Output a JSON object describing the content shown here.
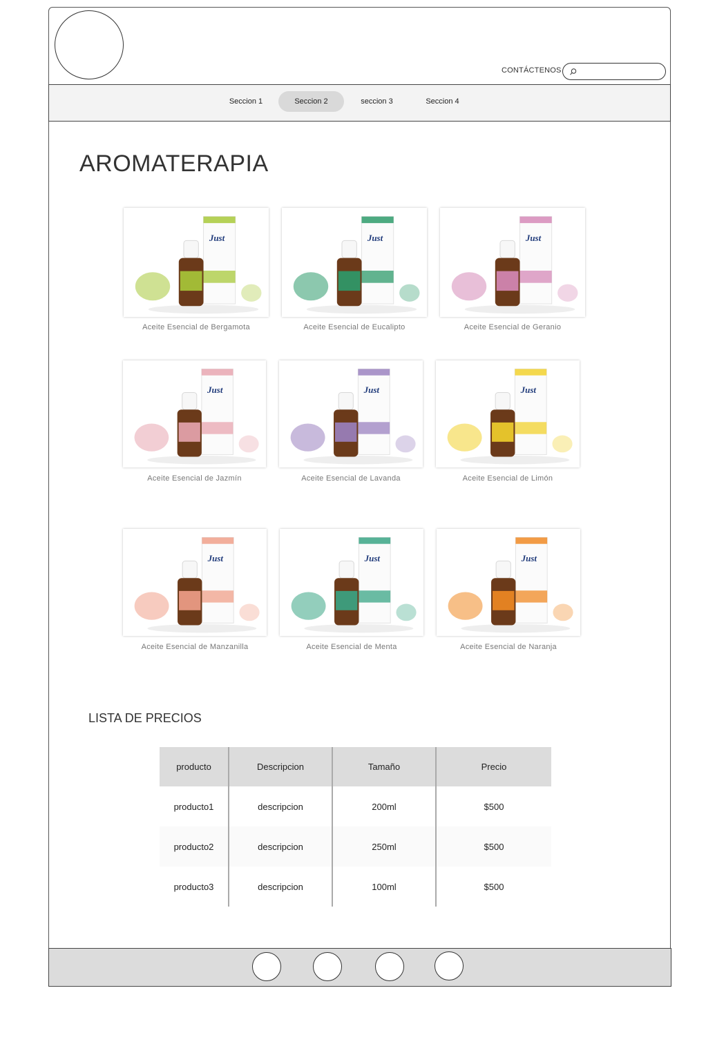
{
  "header": {
    "contact_label": "CONTÁCTENOS",
    "search_placeholder": ""
  },
  "nav": {
    "items": [
      {
        "label": "Seccion 1",
        "active": false
      },
      {
        "label": "Seccion 2",
        "active": true
      },
      {
        "label": "seccion 3",
        "active": false
      },
      {
        "label": "Seccion 4",
        "active": false
      }
    ]
  },
  "main": {
    "title": "AROMATERAPIA",
    "products": [
      {
        "name": "Aceite Esencial de Bergamota",
        "accent": "#a8c93a",
        "icon": "bergamot-product-photo"
      },
      {
        "name": "Aceite Esencial de Eucalipto",
        "accent": "#2e9b6b",
        "icon": "eucalyptus-product-photo"
      },
      {
        "name": "Aceite Esencial de Geranio",
        "accent": "#d68ab8",
        "icon": "geranium-product-photo"
      },
      {
        "name": "Aceite Esencial de Jazmín",
        "accent": "#e8a6b0",
        "icon": "jasmine-product-photo"
      },
      {
        "name": "Aceite Esencial de Lavanda",
        "accent": "#9b82c0",
        "icon": "lavender-product-photo"
      },
      {
        "name": "Aceite Esencial de Limón",
        "accent": "#f2d12e",
        "icon": "lemon-product-photo"
      },
      {
        "name": "Aceite Esencial de Manzanilla",
        "accent": "#f0a08a",
        "icon": "chamomile-product-photo"
      },
      {
        "name": "Aceite Esencial de Menta",
        "accent": "#3aa585",
        "icon": "mint-product-photo"
      },
      {
        "name": "Aceite Esencial de Naranja",
        "accent": "#f08a24",
        "icon": "orange-product-photo"
      }
    ]
  },
  "prices": {
    "title": "LISTA DE PRECIOS",
    "headers": [
      "producto",
      "Descripcion",
      "Tamaño",
      "Precio"
    ],
    "rows": [
      [
        "producto1",
        "descripcion",
        "200ml",
        "$500"
      ],
      [
        "producto2",
        "descripcion",
        "250ml",
        "$500"
      ],
      [
        "producto3",
        "descripcion",
        "100ml",
        "$500"
      ]
    ]
  },
  "footer": {
    "social_icons": [
      "social-icon-1",
      "social-icon-2",
      "social-icon-3",
      "social-icon-4"
    ]
  },
  "brand": {
    "box_label": "Just"
  }
}
